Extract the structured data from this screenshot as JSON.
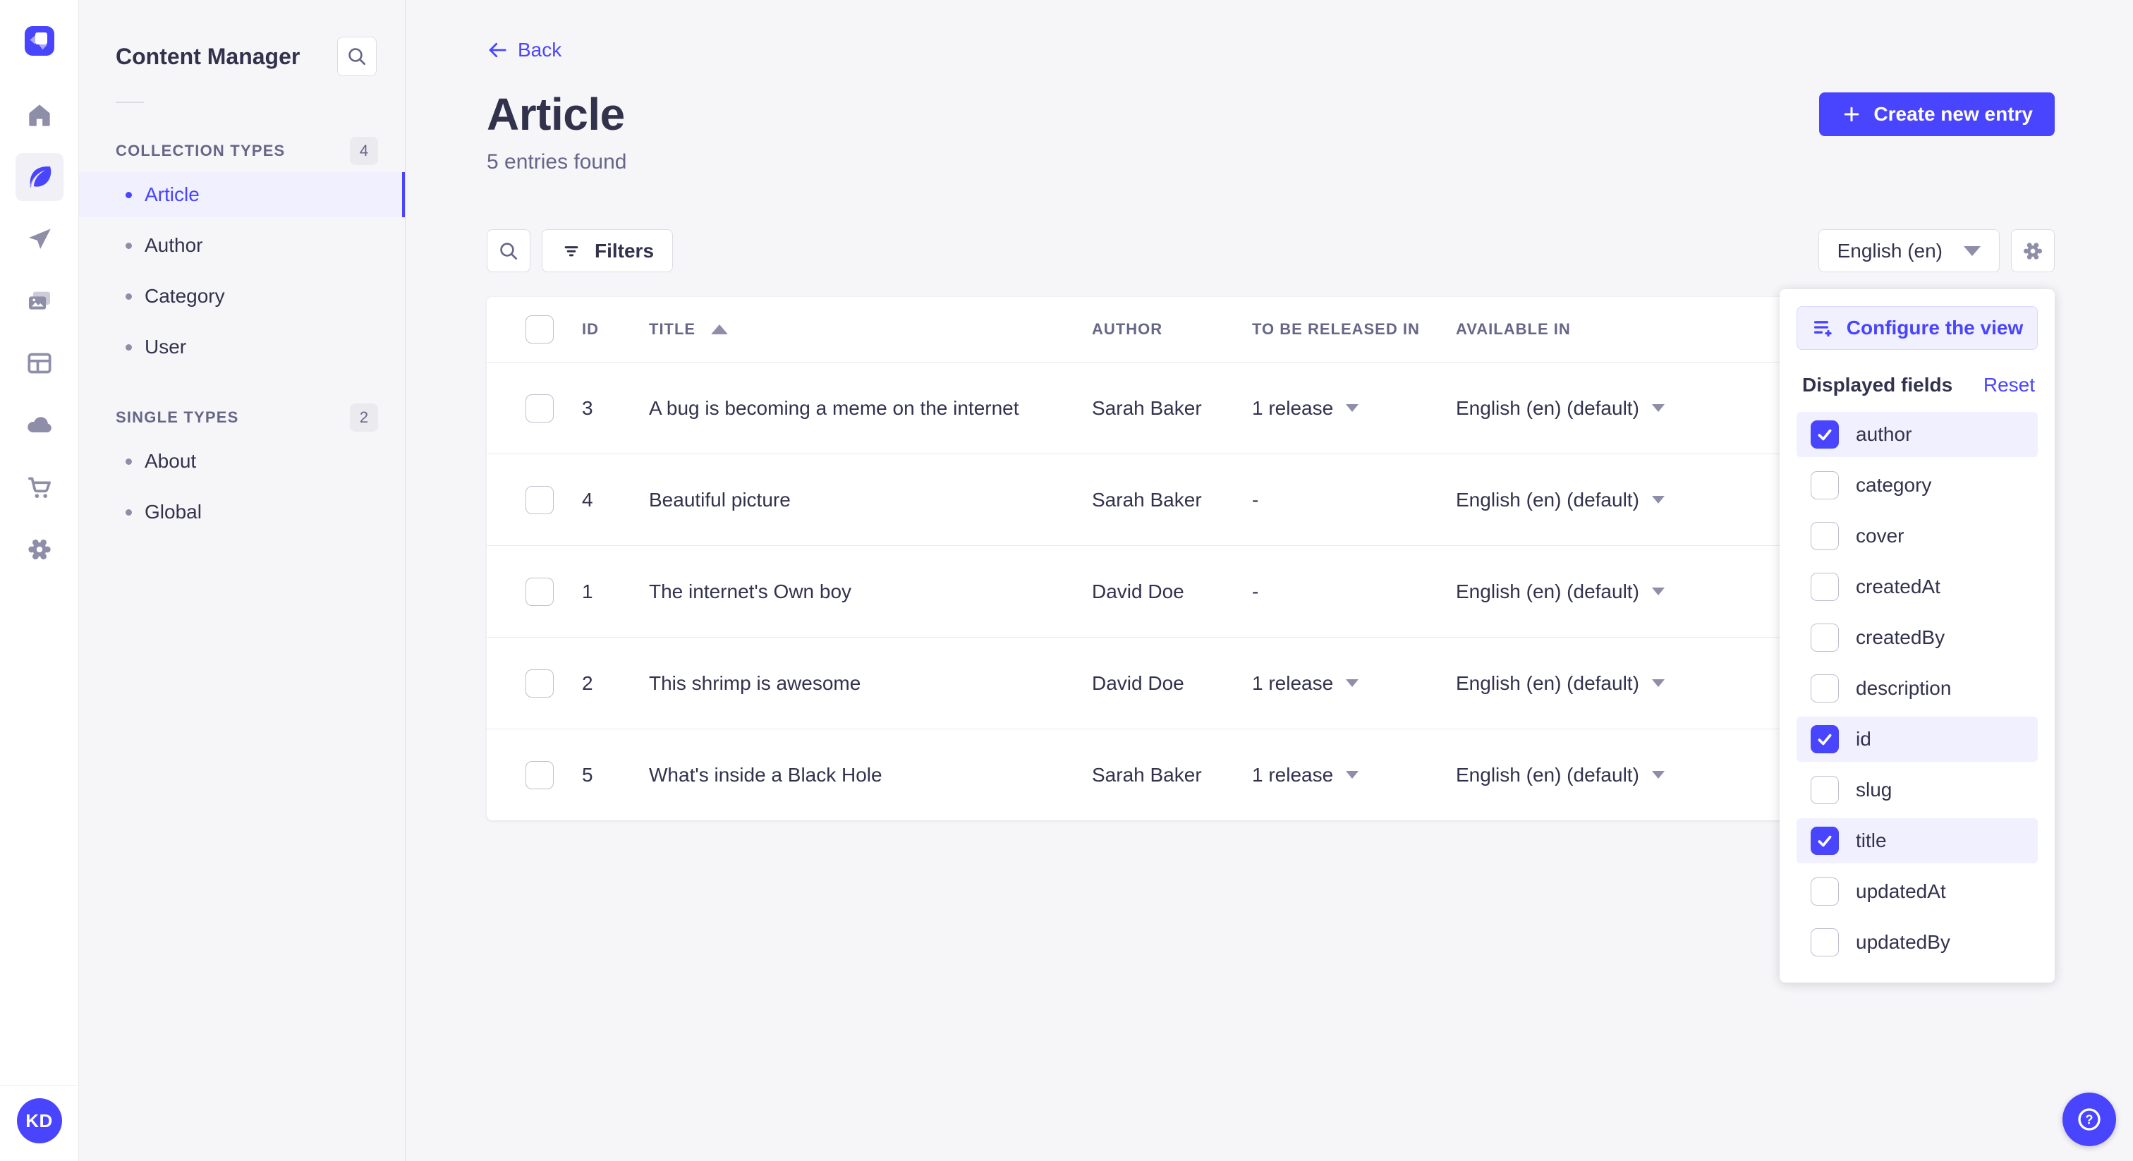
{
  "colors": {
    "primary": "#4945ff",
    "primary_light": "#f0f0ff",
    "text": "#32324d",
    "text_secondary": "#666687",
    "icon_grey": "#8e8ea9",
    "border": "#dcdce4",
    "page_bg": "#f6f6f9"
  },
  "nav_rail": {
    "logo_icon": "strapi-logo",
    "items": [
      {
        "icon": "home-icon",
        "active": false
      },
      {
        "icon": "content-manager-icon",
        "active": true
      },
      {
        "icon": "releases-icon",
        "active": false
      },
      {
        "icon": "media-library-icon",
        "active": false
      },
      {
        "icon": "content-type-builder-icon",
        "active": false
      },
      {
        "icon": "deploy-icon",
        "active": false
      },
      {
        "icon": "marketplace-icon",
        "active": false
      },
      {
        "icon": "settings-icon",
        "active": false
      }
    ],
    "user_initials": "KD"
  },
  "sidebar": {
    "title": "Content Manager",
    "search_icon": "search-icon",
    "sections": [
      {
        "label": "COLLECTION TYPES",
        "count": "4",
        "items": [
          {
            "label": "Article",
            "active": true
          },
          {
            "label": "Author",
            "active": false
          },
          {
            "label": "Category",
            "active": false
          },
          {
            "label": "User",
            "active": false
          }
        ]
      },
      {
        "label": "SINGLE TYPES",
        "count": "2",
        "items": [
          {
            "label": "About",
            "active": false
          },
          {
            "label": "Global",
            "active": false
          }
        ]
      }
    ]
  },
  "header": {
    "back_label": "Back",
    "title": "Article",
    "subtitle": "5 entries found",
    "create_button_label": "Create new entry"
  },
  "toolbar": {
    "filters_label": "Filters",
    "locale_value": "English (en)"
  },
  "table": {
    "columns": [
      {
        "label": "ID"
      },
      {
        "label": "TITLE",
        "sorted": "asc"
      },
      {
        "label": "AUTHOR"
      },
      {
        "label": "TO BE RELEASED IN"
      },
      {
        "label": "AVAILABLE IN"
      }
    ],
    "rows": [
      {
        "id": "3",
        "title": "A bug is becoming a meme on the internet",
        "author": "Sarah Baker",
        "to_be_released_in": "1 release",
        "has_release": true,
        "available_in": "English (en) (default)"
      },
      {
        "id": "4",
        "title": "Beautiful picture",
        "author": "Sarah Baker",
        "to_be_released_in": "-",
        "has_release": false,
        "available_in": "English (en) (default)"
      },
      {
        "id": "1",
        "title": "The internet's Own boy",
        "author": "David Doe",
        "to_be_released_in": "-",
        "has_release": false,
        "available_in": "English (en) (default)"
      },
      {
        "id": "2",
        "title": "This shrimp is awesome",
        "author": "David Doe",
        "to_be_released_in": "1 release",
        "has_release": true,
        "available_in": "English (en) (default)"
      },
      {
        "id": "5",
        "title": "What's inside a Black Hole",
        "author": "Sarah Baker",
        "to_be_released_in": "1 release",
        "has_release": true,
        "available_in": "English (en) (default)"
      }
    ]
  },
  "popover": {
    "configure_button_label": "Configure the view",
    "section_title": "Displayed fields",
    "reset_label": "Reset",
    "fields": [
      {
        "label": "author",
        "checked": true
      },
      {
        "label": "category",
        "checked": false
      },
      {
        "label": "cover",
        "checked": false
      },
      {
        "label": "createdAt",
        "checked": false
      },
      {
        "label": "createdBy",
        "checked": false
      },
      {
        "label": "description",
        "checked": false
      },
      {
        "label": "id",
        "checked": true
      },
      {
        "label": "slug",
        "checked": false
      },
      {
        "label": "title",
        "checked": true
      },
      {
        "label": "updatedAt",
        "checked": false
      },
      {
        "label": "updatedBy",
        "checked": false
      }
    ]
  },
  "user": {
    "initials": "KD"
  },
  "help": {
    "icon": "help-icon"
  }
}
